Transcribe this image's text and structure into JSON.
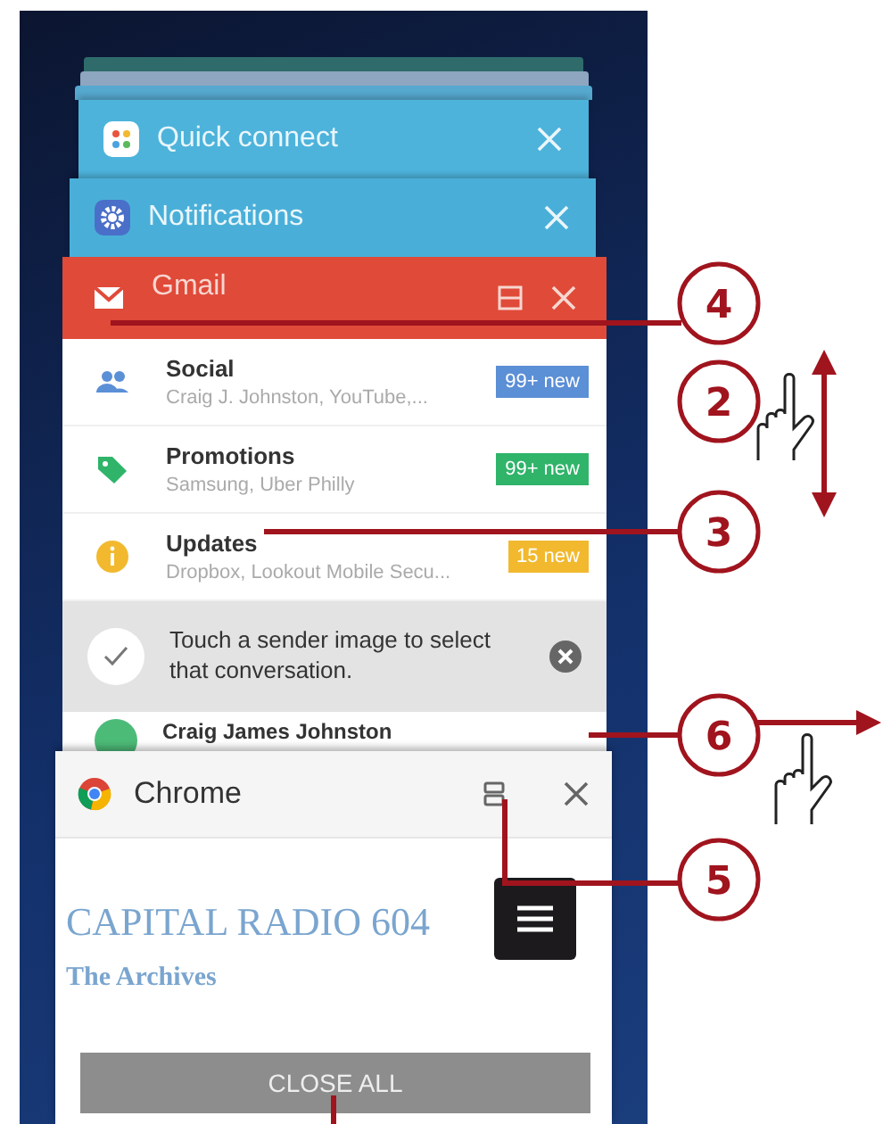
{
  "recent_apps": [
    {
      "title": "Quick connect",
      "color": "#4db3db"
    },
    {
      "title": "Notifications",
      "color": "#4aafd8"
    }
  ],
  "gmail_card": {
    "title": "Gmail",
    "categories": [
      {
        "name": "Social",
        "senders": "Craig J. Johnston, YouTube,...",
        "badge": "99+ new",
        "color": "#5b8fd6"
      },
      {
        "name": "Promotions",
        "senders": "Samsung, Uber Philly",
        "badge": "99+ new",
        "color": "#2fb46a"
      },
      {
        "name": "Updates",
        "senders": "Dropbox, Lookout Mobile Secu...",
        "badge": "15 new",
        "color": "#f2b92f"
      }
    ],
    "tip": "Touch a sender image to select that conversation.",
    "next_sender": "Craig James Johnston"
  },
  "chrome_card": {
    "title": "Chrome",
    "site_title": "CAPITAL RADIO 604",
    "site_subtitle": "The Archives"
  },
  "close_all_button": "CLOSE ALL",
  "callouts": [
    {
      "label": "4"
    },
    {
      "label": "2"
    },
    {
      "label": "3"
    },
    {
      "label": "6"
    },
    {
      "label": "5"
    }
  ]
}
